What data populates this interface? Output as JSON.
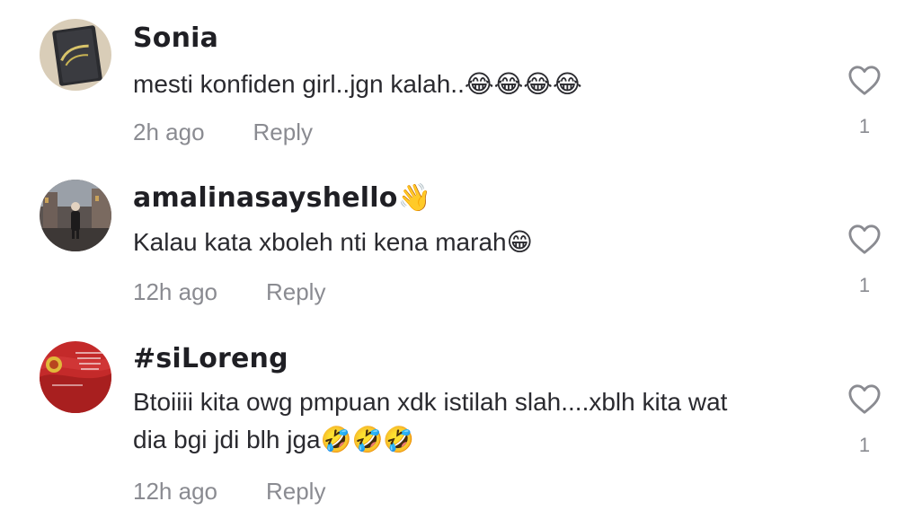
{
  "comments": [
    {
      "username": "Sonia",
      "text": "mesti konfiden girl..jgn kalah..😂😂😂😂",
      "time": "2h ago",
      "reply": "Reply",
      "likes": "1",
      "avatar_icon": "journal-book-avatar"
    },
    {
      "username": "amalinasayshello👋",
      "text": "Kalau kata xboleh nti kena marah😁",
      "time": "12h ago",
      "reply": "Reply",
      "likes": "1",
      "avatar_icon": "street-photo-avatar"
    },
    {
      "username": "#siLoreng",
      "text": "Btoiiii kita owg pmpuan xdk istilah slah....xblh kita wat\ndia bgi jdi blh jga🤣🤣🤣",
      "time": "12h ago",
      "reply": "Reply",
      "likes": "1",
      "avatar_icon": "red-flag-avatar"
    }
  ],
  "colors": {
    "username": "#1f1f24",
    "text": "#2a2a2f",
    "meta": "#8a8b91",
    "heart": "#8a8b91"
  }
}
